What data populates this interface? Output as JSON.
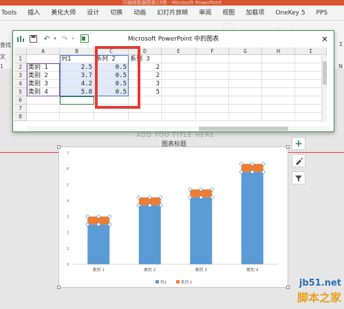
{
  "app": {
    "doc_title": "可编辑数据图表15例 - Microsoft PowerPoint",
    "ribbon_tabs": [
      "Tools",
      "插入",
      "美化大师",
      "设计",
      "切换",
      "动画",
      "幻灯片放映",
      "审阅",
      "视图",
      "加载项",
      "OneKey 5",
      "PPS"
    ],
    "left_stubs": [
      "查找",
      "文",
      "1",
      "1"
    ],
    "right_stubs": [
      "Σ",
      "N",
      "N"
    ]
  },
  "spreadsheet": {
    "title": "Microsoft PowerPoint 中的图表",
    "close_icon": "close-icon",
    "columns": [
      "A",
      "B",
      "C",
      "D",
      "E",
      "F",
      "G",
      "H",
      "I"
    ],
    "rows": [
      "1",
      "2",
      "3",
      "4",
      "5",
      "6",
      "7",
      "8"
    ],
    "header_row": [
      "",
      "列1",
      "系列 2",
      "系列 3"
    ],
    "data": [
      [
        "类别 1",
        "2.5",
        "0.5",
        "2"
      ],
      [
        "类别 2",
        "3.7",
        "0.5",
        "2"
      ],
      [
        "类别 3",
        "4.2",
        "0.5",
        "3"
      ],
      [
        "类别 4",
        "5.8",
        "0.5",
        "5"
      ]
    ]
  },
  "chart": {
    "title": "图表标题",
    "slide_caption": "ADD YOU TITLE HERE",
    "legend": [
      "列1",
      "系列 2"
    ]
  },
  "chart_data": {
    "type": "bar",
    "stacked": true,
    "categories": [
      "类别 1",
      "类别 2",
      "类别 3",
      "类别 4"
    ],
    "series": [
      {
        "name": "列1",
        "values": [
          2.5,
          3.7,
          4.2,
          5.8
        ],
        "color": "#5b9bd5"
      },
      {
        "name": "系列 2",
        "values": [
          0.5,
          0.5,
          0.5,
          0.5
        ],
        "color": "#ed7d31"
      }
    ],
    "ylim": [
      0,
      7
    ],
    "yticks": [
      "0",
      "1",
      "2",
      "3",
      "4",
      "5",
      "6",
      "7"
    ],
    "title": "图表标题",
    "xlabel": "",
    "ylabel": "",
    "grid": false,
    "legend": "bottom"
  },
  "side_buttons": [
    "plus-icon",
    "brush-icon",
    "filter-icon"
  ],
  "watermark": {
    "line1": "jb51.net",
    "line2": "脚本之家"
  },
  "colors": {
    "accent_ribbon": "#d9532c",
    "excel_green": "#3d8b4a",
    "highlight": "#e53935"
  }
}
